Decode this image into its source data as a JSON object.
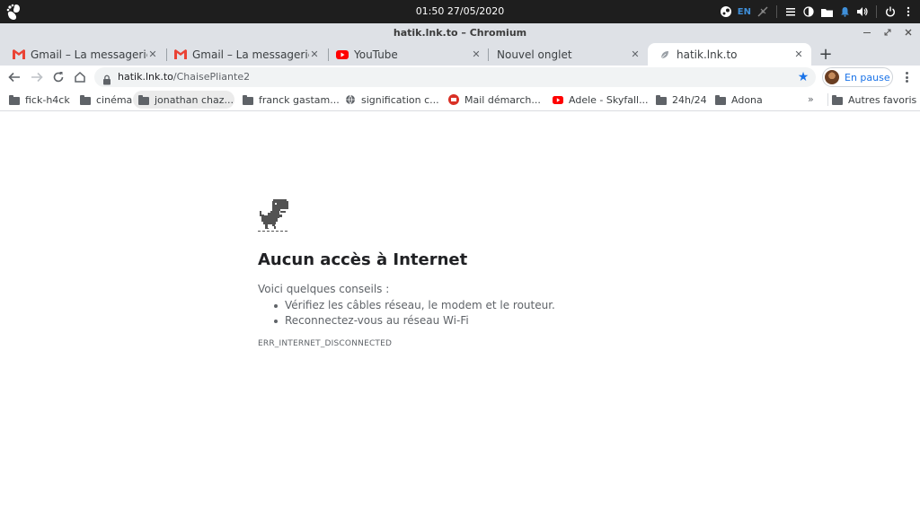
{
  "system_bar": {
    "clock": "01:50 27/05/2020",
    "input_language": "EN"
  },
  "window": {
    "title": "hatik.lnk.to – Chromium"
  },
  "tabs": [
    {
      "label": "Gmail – La messagerie ave",
      "favicon": "gmail-icon",
      "active": false
    },
    {
      "label": "Gmail – La messagerie ave",
      "favicon": "gmail-icon",
      "active": false
    },
    {
      "label": "YouTube",
      "favicon": "youtube-icon",
      "active": false
    },
    {
      "label": "Nouvel onglet",
      "favicon": "none",
      "active": false
    },
    {
      "label": "hatik.lnk.to",
      "favicon": "offline-leaf-icon",
      "active": true
    }
  ],
  "toolbar": {
    "url_host": "hatik.lnk.to",
    "url_path": "/ChaisePliante2",
    "profile_label": "En pause"
  },
  "bookmarks": [
    {
      "label": "fick-h4ck",
      "icon": "folder-icon"
    },
    {
      "label": "cinéma",
      "icon": "folder-icon"
    },
    {
      "label": "jonathan chaz...",
      "icon": "folder-icon"
    },
    {
      "label": "franck gastam...",
      "icon": "folder-icon"
    },
    {
      "label": "signification c...",
      "icon": "globe-icon"
    },
    {
      "label": "Mail démarch...",
      "icon": "mail-site-icon"
    },
    {
      "label": "Adele - Skyfall...",
      "icon": "youtube-icon"
    },
    {
      "label": "24h/24",
      "icon": "folder-icon"
    },
    {
      "label": "Adona",
      "icon": "folder-icon"
    }
  ],
  "bookmarks_overflow": "»",
  "other_bookmarks": "Autres favoris",
  "error_page": {
    "title": "Aucun accès à Internet",
    "intro": "Voici quelques conseils :",
    "suggestions": [
      "Vérifiez les câbles réseau, le modem et le routeur.",
      "Reconnectez-vous au réseau Wi-Fi"
    ],
    "error_code": "ERR_INTERNET_DISCONNECTED"
  },
  "colors": {
    "accent": "#1a73e8",
    "tabstrip": "#dee1e6",
    "gmail_red": "#ea4335",
    "youtube_red": "#ff0000"
  }
}
